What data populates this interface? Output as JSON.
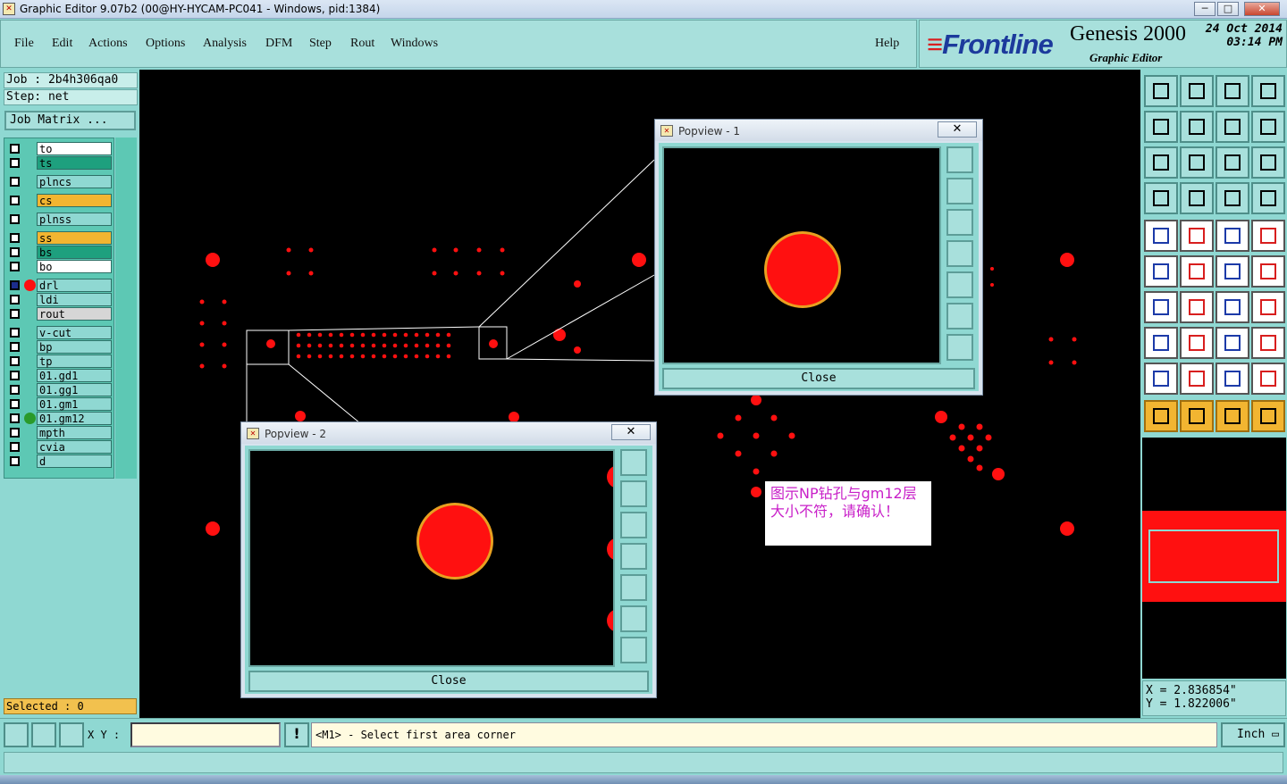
{
  "window": {
    "title": "Graphic Editor 9.07b2 (00@HY-HYCAM-PC041 - Windows, pid:1384)",
    "minimize": "─",
    "maximize": "□",
    "close": "✕"
  },
  "menu": {
    "items": [
      "File",
      "Edit",
      "Actions",
      "Options",
      "Analysis",
      "DFM",
      "Step",
      "Rout",
      "Windows"
    ],
    "help": "Help"
  },
  "brand": {
    "logo": "Frontline",
    "product": "Genesis 2000",
    "subtitle": "Graphic Editor",
    "date": "24 Oct 2014",
    "time": "03:14 PM"
  },
  "job": {
    "job_line": "Job : 2b4h306qa0",
    "step_line": "Step: net",
    "job_matrix": "Job Matrix ..."
  },
  "layers": [
    {
      "name": "to",
      "color": "#ffffff"
    },
    {
      "name": "ts",
      "color": "#1ea07e"
    },
    {
      "name": "plncs",
      "color": "#8fd8d2"
    },
    {
      "name": "cs",
      "color": "#f2b531"
    },
    {
      "name": "plnss",
      "color": "#8fd8d2"
    },
    {
      "name": "ss",
      "color": "#f2b531"
    },
    {
      "name": "bs",
      "color": "#1ea07e"
    },
    {
      "name": "bo",
      "color": "#ffffff"
    },
    {
      "name": "drl",
      "color": "#8fd8d2",
      "dot": "#ff1010",
      "active": true
    },
    {
      "name": "ldi",
      "color": "#8fd8d2"
    },
    {
      "name": "rout",
      "color": "#d6d6d6"
    },
    {
      "name": "v-cut",
      "color": "#8fd8d2"
    },
    {
      "name": "bp",
      "color": "#8fd8d2"
    },
    {
      "name": "tp",
      "color": "#8fd8d2"
    },
    {
      "name": "01.gd1",
      "color": "#8fd8d2"
    },
    {
      "name": "01.gg1",
      "color": "#8fd8d2"
    },
    {
      "name": "01.gm1",
      "color": "#8fd8d2"
    },
    {
      "name": "01.gm12",
      "color": "#8fd8d2",
      "dot": "#2a9a2a"
    },
    {
      "name": "mpth",
      "color": "#8fd8d2"
    },
    {
      "name": "cvia",
      "color": "#8fd8d2"
    },
    {
      "name": "d",
      "color": "#8fd8d2"
    }
  ],
  "selected": "Selected : 0",
  "note": {
    "line1": "图示NP钻孔与gm12层",
    "line2": "大小不符，请确认！"
  },
  "popup1": {
    "title": "Popview - 1",
    "close_label": "Close"
  },
  "popup2": {
    "title": "Popview - 2",
    "close_label": "Close"
  },
  "coords": {
    "x": "X = 2.836854\"",
    "y": "Y = 1.822006\""
  },
  "bottom": {
    "xy_label": "X Y :",
    "xy_value": "",
    "warn": "!",
    "message": "<M1> - Select first area corner",
    "unit": "Inch"
  },
  "colors": {
    "pad": "#ff1010",
    "ring": "#e8a020",
    "panel": "#8fd8d2",
    "canvas": "#000000"
  }
}
